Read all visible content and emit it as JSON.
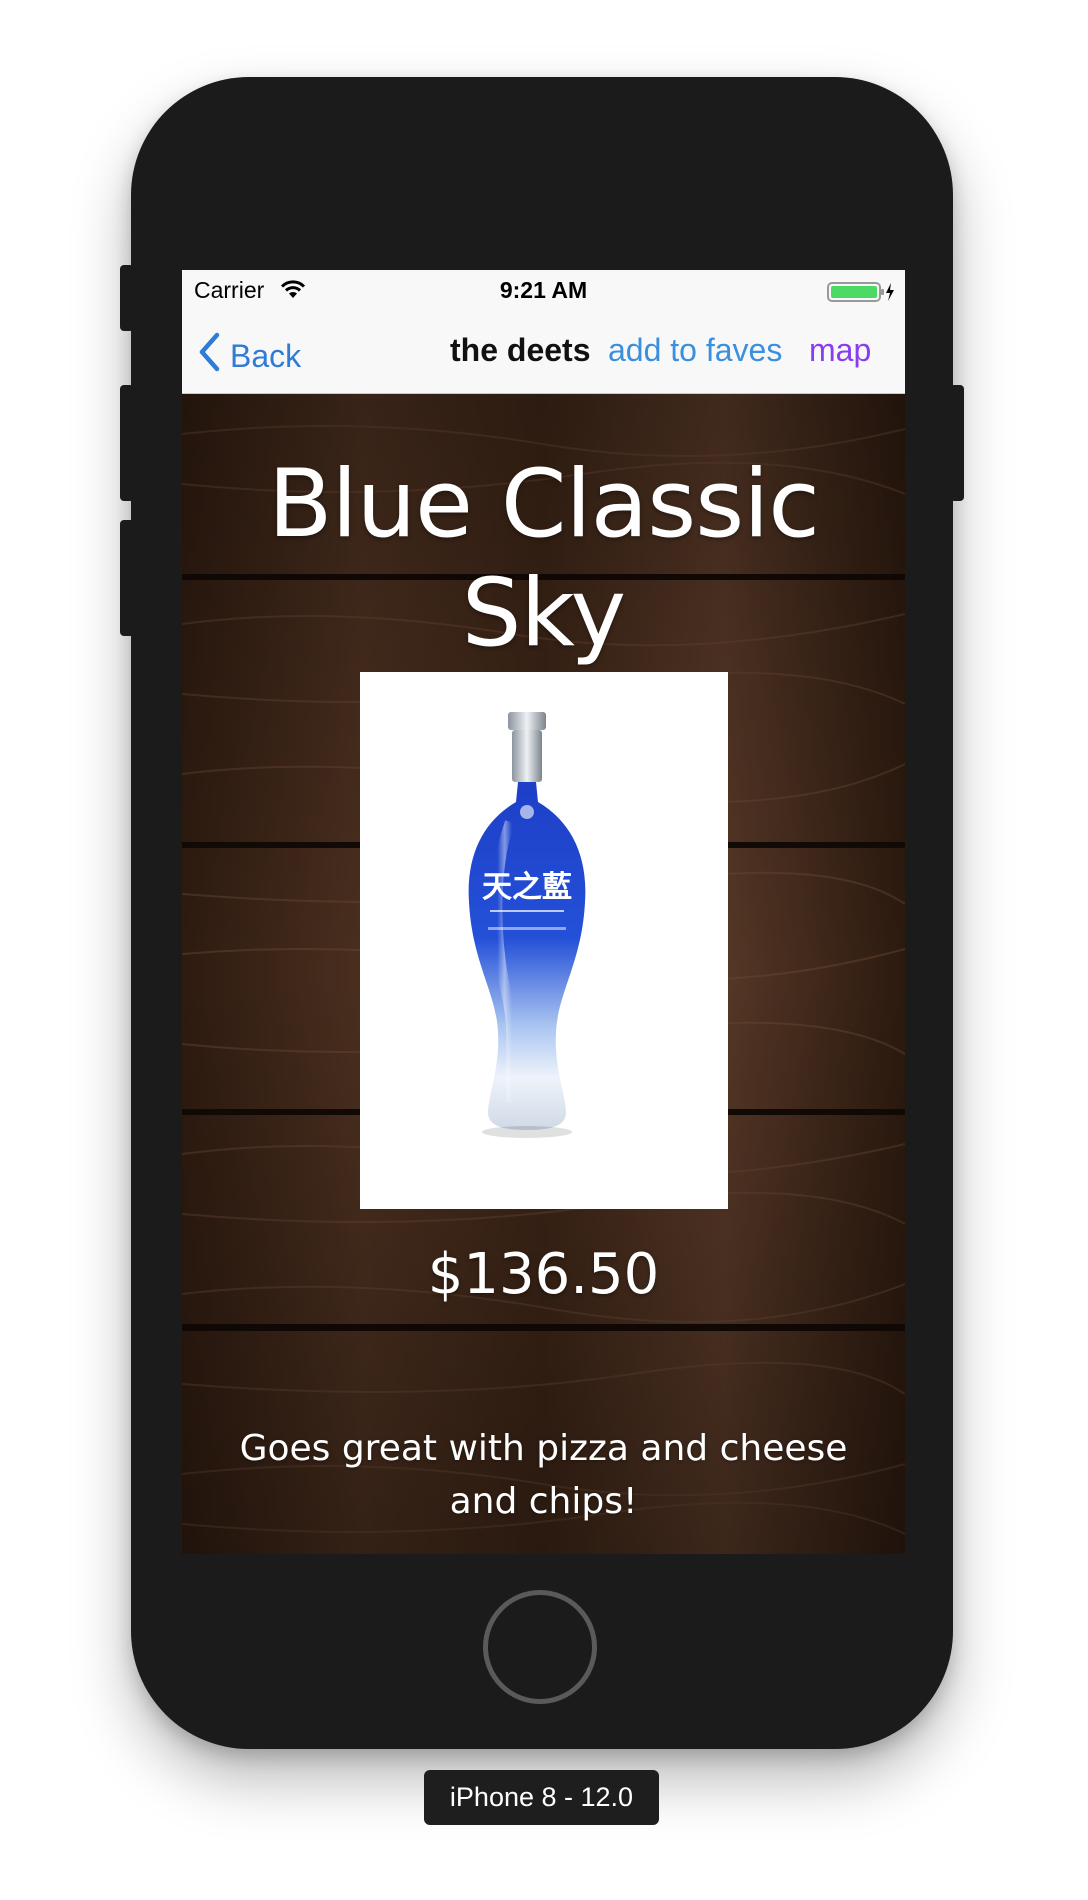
{
  "status_bar": {
    "carrier": "Carrier",
    "time": "9:21 AM",
    "wifi_icon": "wifi-icon",
    "battery_icon": "battery-charging-icon",
    "battery_color": "#4cd964"
  },
  "nav": {
    "back_label": "Back",
    "title": "the deets",
    "faves_label": "add to faves",
    "map_label": "map",
    "back_color": "#2f7bd6",
    "faves_color": "#3a8fde",
    "map_color": "#8a3cf0"
  },
  "product": {
    "name": "Blue Classic Sky",
    "price": "$136.50",
    "description": "Goes great with pizza and cheese and chips!",
    "image_icon": "liquor-bottle-image"
  },
  "device": {
    "label": "iPhone 8 - 12.0"
  }
}
